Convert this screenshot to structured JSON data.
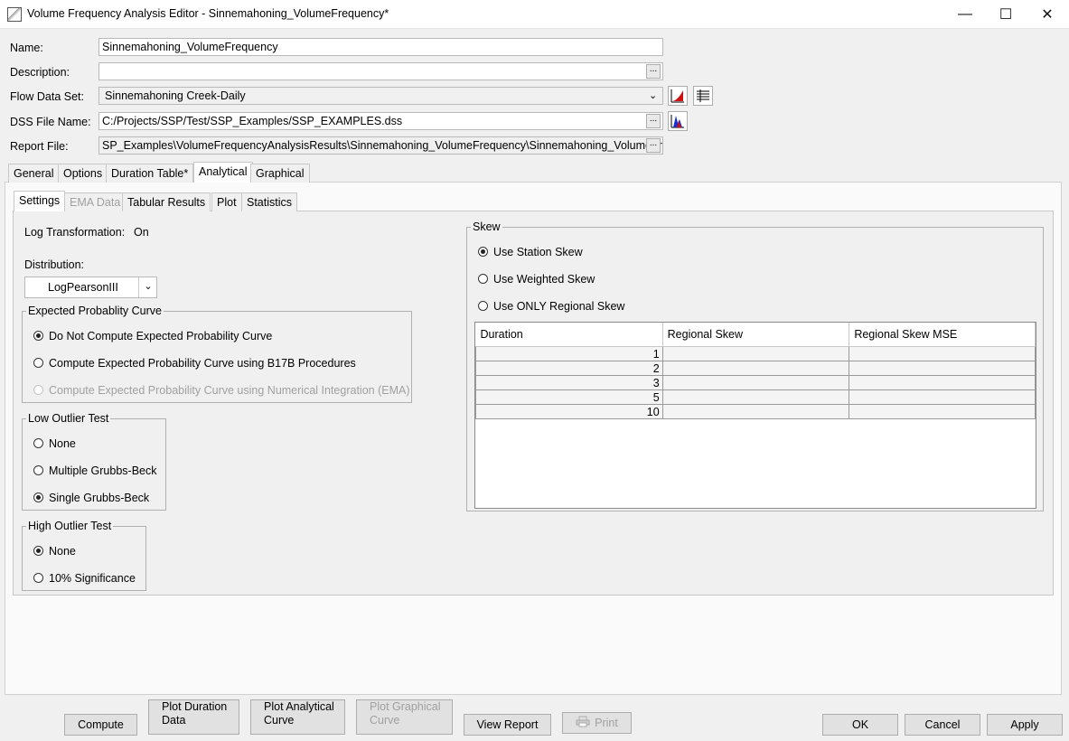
{
  "window": {
    "title": "Volume Frequency Analysis Editor - Sinnemahoning_VolumeFrequency*"
  },
  "form": {
    "name_label": "Name:",
    "name_value": "Sinnemahoning_VolumeFrequency",
    "description_label": "Description:",
    "description_value": "",
    "flow_label": "Flow Data Set:",
    "flow_value": "Sinnemahoning Creek-Daily",
    "dss_label": "DSS File Name:",
    "dss_value": "C:/Projects/SSP/Test/SSP_Examples/SSP_EXAMPLES.dss",
    "report_label": "Report File:",
    "report_value": "SP_Examples\\VolumeFrequencyAnalysisResults\\Sinnemahoning_VolumeFrequency\\Sinnemahoning_VolumeFrequ",
    "dots": "..."
  },
  "tabs": [
    "General",
    "Options",
    "Duration Table*",
    "Analytical",
    "Graphical"
  ],
  "subtabs": [
    "Settings",
    "EMA Data",
    "Tabular Results",
    "Plot",
    "Statistics"
  ],
  "settings": {
    "log_label": "Log Transformation:",
    "log_value": "On",
    "dist_label": "Distribution:",
    "dist_value": "LogPearsonIII",
    "epc_title": "Expected Probablity Curve",
    "epc_options": [
      "Do Not Compute Expected Probability Curve",
      "Compute Expected Probability Curve using B17B Procedures",
      "Compute Expected Probability Curve using Numerical Integration (EMA)"
    ],
    "low_title": "Low Outlier Test",
    "low_options": [
      "None",
      "Multiple Grubbs-Beck",
      "Single Grubbs-Beck"
    ],
    "high_title": "High Outlier Test",
    "high_options": [
      "None",
      "10% Significance"
    ]
  },
  "skew": {
    "title": "Skew",
    "options": [
      "Use Station Skew",
      "Use Weighted Skew",
      "Use ONLY Regional Skew"
    ],
    "columns": [
      "Duration",
      "Regional Skew",
      "Regional Skew MSE"
    ],
    "rows": [
      [
        "1",
        "",
        ""
      ],
      [
        "2",
        "",
        ""
      ],
      [
        "3",
        "",
        ""
      ],
      [
        "5",
        "",
        ""
      ],
      [
        "10",
        "",
        ""
      ]
    ]
  },
  "buttons": {
    "compute": "Compute",
    "plot_duration_1": "Plot Duration",
    "plot_duration_2": "Data",
    "plot_analytical_1": "Plot Analytical",
    "plot_analytical_2": "Curve",
    "plot_graphical_1": "Plot Graphical",
    "plot_graphical_2": "Curve",
    "view_report": "View Report",
    "print": "Print",
    "ok": "OK",
    "cancel": "Cancel",
    "apply": "Apply"
  }
}
